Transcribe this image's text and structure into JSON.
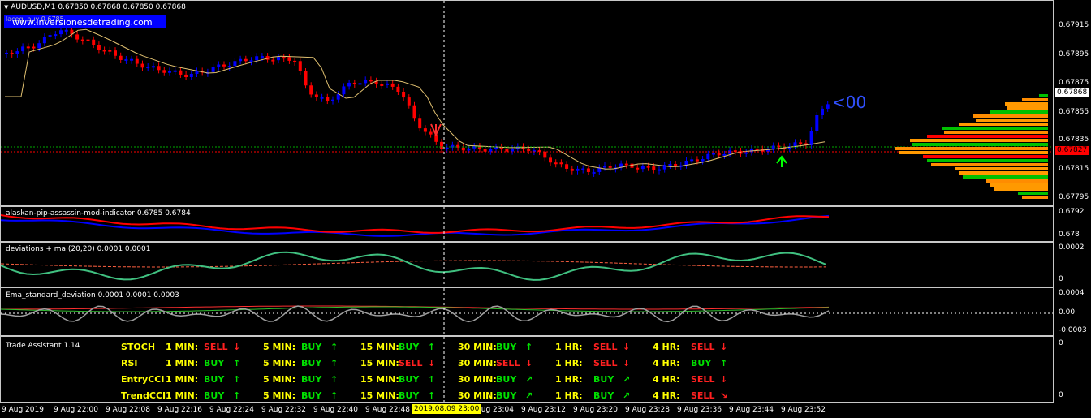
{
  "header": {
    "symbol_line": "AUDUSD,M1  0.67850 0.67868 0.67850 0.67868",
    "website": "www.inversionesdetrading.com",
    "sub_label": "lacegi buy 0.6785"
  },
  "main_pane": {
    "price_scale": [
      "0.67915",
      "0.67895",
      "0.67875",
      "0.67855",
      "0.67835",
      "0.67815",
      "0.67795"
    ],
    "current_price": "0.67868",
    "bid_price": "0.67827",
    "overlay_text": "<00"
  },
  "indicator1": {
    "title": "alaskan-pip-assassin-mod-indicator 0.6785 0.6784",
    "scale": [
      "0.6792",
      "0.678"
    ]
  },
  "indicator2": {
    "title": "deviations + ma (20,20) 0.0001 0.0001",
    "scale": [
      "0.0002",
      "0"
    ]
  },
  "indicator3": {
    "title": "Ema_standard_deviation 0.0001 0.0001 0.0003",
    "scale": [
      "0.0004",
      "0.00",
      "-0.0003"
    ]
  },
  "trade_assistant": {
    "title": "Trade Assistant 1.14",
    "scale": [
      "0",
      "0"
    ],
    "rows": [
      {
        "name": "STOCH",
        "cells": [
          {
            "tf": "1 MIN:",
            "sig": "SELL",
            "arrow": "↓",
            "type": "sell"
          },
          {
            "tf": "5 MIN:",
            "sig": "BUY",
            "arrow": "↑",
            "type": "buy"
          },
          {
            "tf": "15 MIN:",
            "sig": "BUY",
            "arrow": "↑",
            "type": "buy"
          },
          {
            "tf": "30 MIN:",
            "sig": "BUY",
            "arrow": "↑",
            "type": "buy"
          },
          {
            "tf": "1 HR:",
            "sig": "SELL",
            "arrow": "↓",
            "type": "sell"
          },
          {
            "tf": "4 HR:",
            "sig": "SELL",
            "arrow": "↓",
            "type": "sell"
          }
        ]
      },
      {
        "name": "RSI",
        "cells": [
          {
            "tf": "1 MIN:",
            "sig": "BUY",
            "arrow": "↑",
            "type": "buy"
          },
          {
            "tf": "5 MIN:",
            "sig": "BUY",
            "arrow": "↑",
            "type": "buy"
          },
          {
            "tf": "15 MIN:",
            "sig": "SELL",
            "arrow": "↓",
            "type": "sell"
          },
          {
            "tf": "30 MIN:",
            "sig": "SELL",
            "arrow": "↓",
            "type": "sell"
          },
          {
            "tf": "1 HR:",
            "sig": "SELL",
            "arrow": "↓",
            "type": "sell"
          },
          {
            "tf": "4 HR:",
            "sig": "BUY",
            "arrow": "↑",
            "type": "buy"
          }
        ]
      },
      {
        "name": "EntryCCI",
        "cells": [
          {
            "tf": "1 MIN:",
            "sig": "BUY",
            "arrow": "↑",
            "type": "buy"
          },
          {
            "tf": "5 MIN:",
            "sig": "BUY",
            "arrow": "↑",
            "type": "buy"
          },
          {
            "tf": "15 MIN:",
            "sig": "BUY",
            "arrow": "↑",
            "type": "buy"
          },
          {
            "tf": "30 MIN:",
            "sig": "BUY",
            "arrow": "↗",
            "type": "buy"
          },
          {
            "tf": "1 HR:",
            "sig": "BUY",
            "arrow": "↗",
            "type": "buy"
          },
          {
            "tf": "4 HR:",
            "sig": "SELL",
            "arrow": "↓",
            "type": "sell"
          }
        ]
      },
      {
        "name": "TrendCCI",
        "cells": [
          {
            "tf": "1 MIN:",
            "sig": "BUY",
            "arrow": "↑",
            "type": "buy"
          },
          {
            "tf": "5 MIN:",
            "sig": "BUY",
            "arrow": "↑",
            "type": "buy"
          },
          {
            "tf": "15 MIN:",
            "sig": "BUY",
            "arrow": "↑",
            "type": "buy"
          },
          {
            "tf": "30 MIN:",
            "sig": "BUY",
            "arrow": "↗",
            "type": "buy"
          },
          {
            "tf": "1 HR:",
            "sig": "BUY",
            "arrow": "↗",
            "type": "buy"
          },
          {
            "tf": "4 HR:",
            "sig": "SELL",
            "arrow": "↘",
            "type": "sell"
          }
        ]
      }
    ]
  },
  "time_axis": {
    "labels": [
      "9 Aug 2019",
      "9 Aug 22:00",
      "9 Aug 22:08",
      "9 Aug 22:16",
      "9 Aug 22:24",
      "9 Aug 22:32",
      "9 Aug 22:40",
      "9 Aug 22:48",
      "9 Aug 23:04",
      "9 Aug 23:12",
      "9 Aug 23:20",
      "9 Aug 23:28",
      "9 Aug 23:36",
      "9 Aug 23:44",
      "9 Aug 23:52"
    ],
    "cursor_label": "2019.08.09 23:00"
  },
  "colors": {
    "bull": "#0000ff",
    "bear": "#ff0000",
    "ma": "#e0c070",
    "buy": "#00e000",
    "sell": "#ff2020",
    "label": "#ffff00"
  }
}
